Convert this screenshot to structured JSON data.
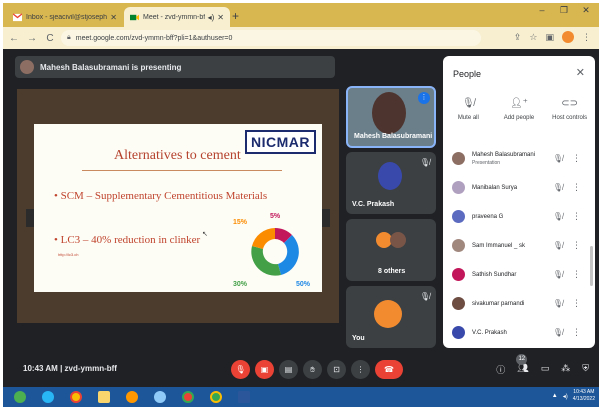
{
  "browser": {
    "tabs": [
      {
        "title": "Inbox - sjeacivil@stjosephs.ac",
        "active": false
      },
      {
        "title": "Meet - zvd-ymmn-bff",
        "active": true
      }
    ],
    "new_tab": "+",
    "url": "meet.google.com/zvd-ymmn-bff?pli=1&authuser=0"
  },
  "meet": {
    "presenting_banner": "Mahesh Balasubramani is presenting",
    "slide": {
      "logo": "NICMAR",
      "title": "Alternatives to cement",
      "bullet1": "• SCM – Supplementary Cementitious Materials",
      "bullet2": "• LC3 – 40% reduction in clinker",
      "link": "http://lc3.ch",
      "chart_labels": [
        "15%",
        "5%",
        "30%",
        "50%"
      ]
    },
    "tiles": [
      {
        "name": "Mahesh Balasubramani"
      },
      {
        "name": "V.C. Prakash"
      },
      {
        "name": "8 others"
      },
      {
        "name": "You"
      }
    ],
    "meeting_time": "10:43 AM",
    "meeting_code": "zvd-ymmn-bff",
    "participant_count": "12"
  },
  "people_panel": {
    "title": "People",
    "actions": [
      {
        "label": "Mute all",
        "icon": "mic-off-icon"
      },
      {
        "label": "Add people",
        "icon": "add-person-icon"
      },
      {
        "label": "Host controls",
        "icon": "toggle-icon"
      }
    ],
    "participants": [
      {
        "name": "Mahesh Balasubramani",
        "sub": "Presentation",
        "color": "#8d6e63"
      },
      {
        "name": "Manibalan Surya",
        "sub": "",
        "color": "#b0a0c0"
      },
      {
        "name": "praveena G",
        "sub": "",
        "color": "#5c6bc0"
      },
      {
        "name": "Sam Immanuel _ sk",
        "sub": "",
        "color": "#a1887f"
      },
      {
        "name": "Sathish Sundhar",
        "sub": "",
        "color": "#c2185b"
      },
      {
        "name": "sivakumar parnandi",
        "sub": "",
        "color": "#6d4c41"
      },
      {
        "name": "V.C. Prakash",
        "sub": "",
        "color": "#3949ab"
      }
    ]
  },
  "taskbar": {
    "time": "10:43 AM",
    "date": "4/13/2022"
  },
  "colors": {
    "meet_bg": "#202124",
    "end_call": "#ea4335",
    "tab_strip": "#d8b650",
    "accent": "#1a73e8"
  }
}
